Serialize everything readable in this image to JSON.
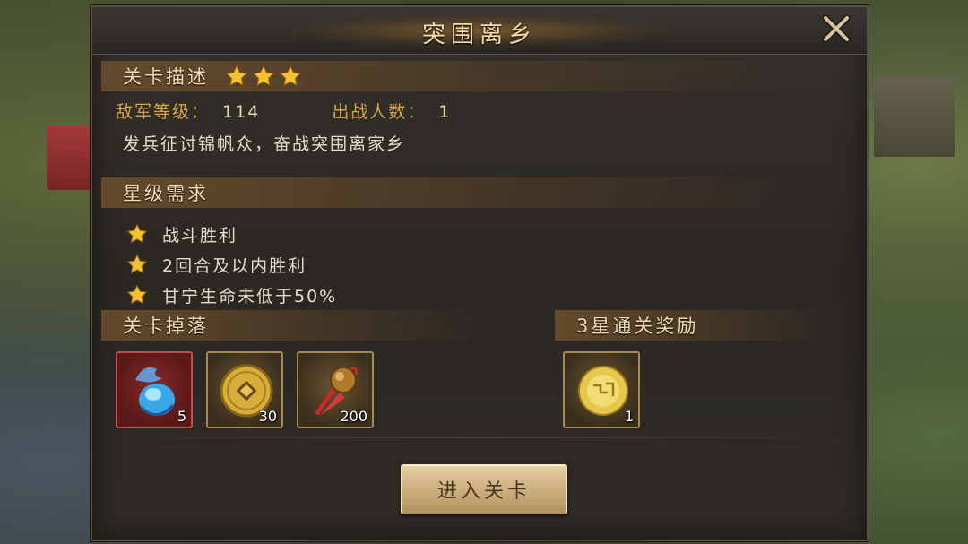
{
  "dialog": {
    "title": "突围离乡"
  },
  "stage_desc": {
    "label": "关卡描述",
    "stars_earned": 3,
    "enemy_level_label": "敌军等级：",
    "enemy_level_value": "114",
    "troop_count_label": "出战人数：",
    "troop_count_value": "1",
    "description": "发兵征讨锦帆众，奋战突围离家乡"
  },
  "star_requirements": {
    "label": "星级需求",
    "items": [
      {
        "text": "战斗胜利"
      },
      {
        "text": "2回合及以内胜利"
      },
      {
        "text": "甘宁生命未低于50%"
      }
    ]
  },
  "drops": {
    "label": "关卡掉落",
    "items": [
      {
        "icon": "blue-spirit-crystal-icon",
        "count": "5"
      },
      {
        "icon": "gold-coin-icon",
        "count": "30"
      },
      {
        "icon": "bronze-bell-icon",
        "count": "200"
      }
    ]
  },
  "three_star_reward": {
    "label": "3星通关奖励",
    "items": [
      {
        "icon": "gold-orb-icon",
        "count": "1"
      }
    ]
  },
  "enter_button": {
    "label": "进入关卡"
  },
  "colors": {
    "panel_bg": "#2e2b26",
    "accent_gold": "#d8a646",
    "star": "#f2c230"
  }
}
